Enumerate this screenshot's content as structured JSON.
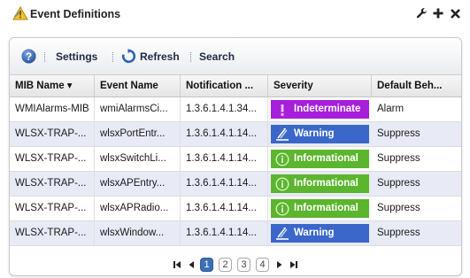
{
  "window": {
    "title": "Event Definitions",
    "tools": [
      "wrench-icon",
      "plus-icon",
      "close-icon"
    ]
  },
  "toolbar": {
    "help_icon": "help-icon",
    "settings_label": "Settings",
    "refresh_label": "Refresh",
    "search_label": "Search"
  },
  "table": {
    "columns": [
      "MIB Name ▾",
      "Event Name",
      "Notification ...",
      "Severity",
      "Default Beh..."
    ],
    "rows": [
      {
        "mib": "WMIAlarms-MIB",
        "event": "wmiAlarmsCi...",
        "oid": "1.3.6.1.4.1.34...",
        "severity": "Indeterminate",
        "default": "Alarm"
      },
      {
        "mib": "WLSX-TRAP-...",
        "event": "wlsxPortEntr...",
        "oid": "1.3.6.1.4.1.14...",
        "severity": "Warning",
        "default": "Suppress"
      },
      {
        "mib": "WLSX-TRAP-...",
        "event": "wlsxSwitchLi...",
        "oid": "1.3.6.1.4.1.14...",
        "severity": "Informational",
        "default": "Suppress"
      },
      {
        "mib": "WLSX-TRAP-...",
        "event": "wlsxAPEntry...",
        "oid": "1.3.6.1.4.1.14...",
        "severity": "Informational",
        "default": "Suppress"
      },
      {
        "mib": "WLSX-TRAP-...",
        "event": "wlsxAPRadio...",
        "oid": "1.3.6.1.4.1.14...",
        "severity": "Informational",
        "default": "Suppress"
      },
      {
        "mib": "WLSX-TRAP-...",
        "event": "wlsxWindow...",
        "oid": "1.3.6.1.4.1.14...",
        "severity": "Warning",
        "default": "Suppress"
      }
    ]
  },
  "severity_colors": {
    "Indeterminate": "#a61fdb",
    "Warning": "#3a67c9",
    "Informational": "#5bb52d"
  },
  "pager": {
    "pages": [
      "1",
      "2",
      "3",
      "4"
    ],
    "current_page": "1"
  }
}
